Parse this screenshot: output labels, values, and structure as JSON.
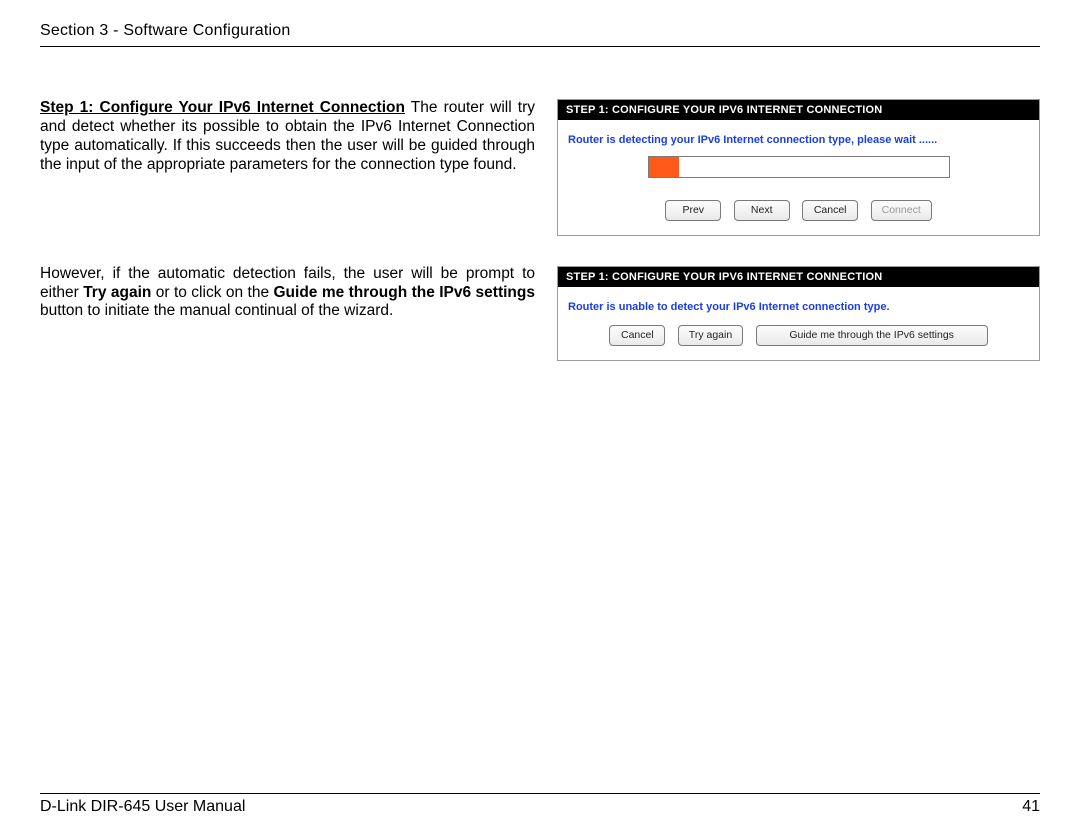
{
  "header": {
    "section_title": "Section 3 - Software Configuration"
  },
  "body": {
    "step_title": "Step 1: Configure Your IPv6 Internet Connection",
    "para1_tail": "The router will try and detect whether its possible to obtain the IPv6 Internet Connection type automatically. If this succeeds then the user will be guided through the input of the appropriate parameters for the connection type found.",
    "para2": {
      "lead": "However, if the automatic detection fails, the user will be prompt to either ",
      "bold1": "Try again",
      "mid": " or to click on the ",
      "bold2": "Guide me through the IPv6 settings",
      "tail": " button to initiate the manual continual of the wizard."
    }
  },
  "wizard1": {
    "header": "STEP 1: CONFIGURE YOUR IPV6 INTERNET CONNECTION",
    "status": "Router is detecting your IPv6 Internet connection type, please wait ......",
    "buttons": {
      "prev": "Prev",
      "next": "Next",
      "cancel": "Cancel",
      "connect": "Connect"
    }
  },
  "wizard2": {
    "header": "STEP 1: CONFIGURE YOUR IPV6 INTERNET CONNECTION",
    "status": "Router is unable to detect your IPv6 Internet connection type.",
    "buttons": {
      "cancel": "Cancel",
      "tryagain": "Try again",
      "guide": "Guide me through the IPv6 settings"
    }
  },
  "footer": {
    "manual": "D-Link DIR-645 User Manual",
    "page": "41"
  }
}
